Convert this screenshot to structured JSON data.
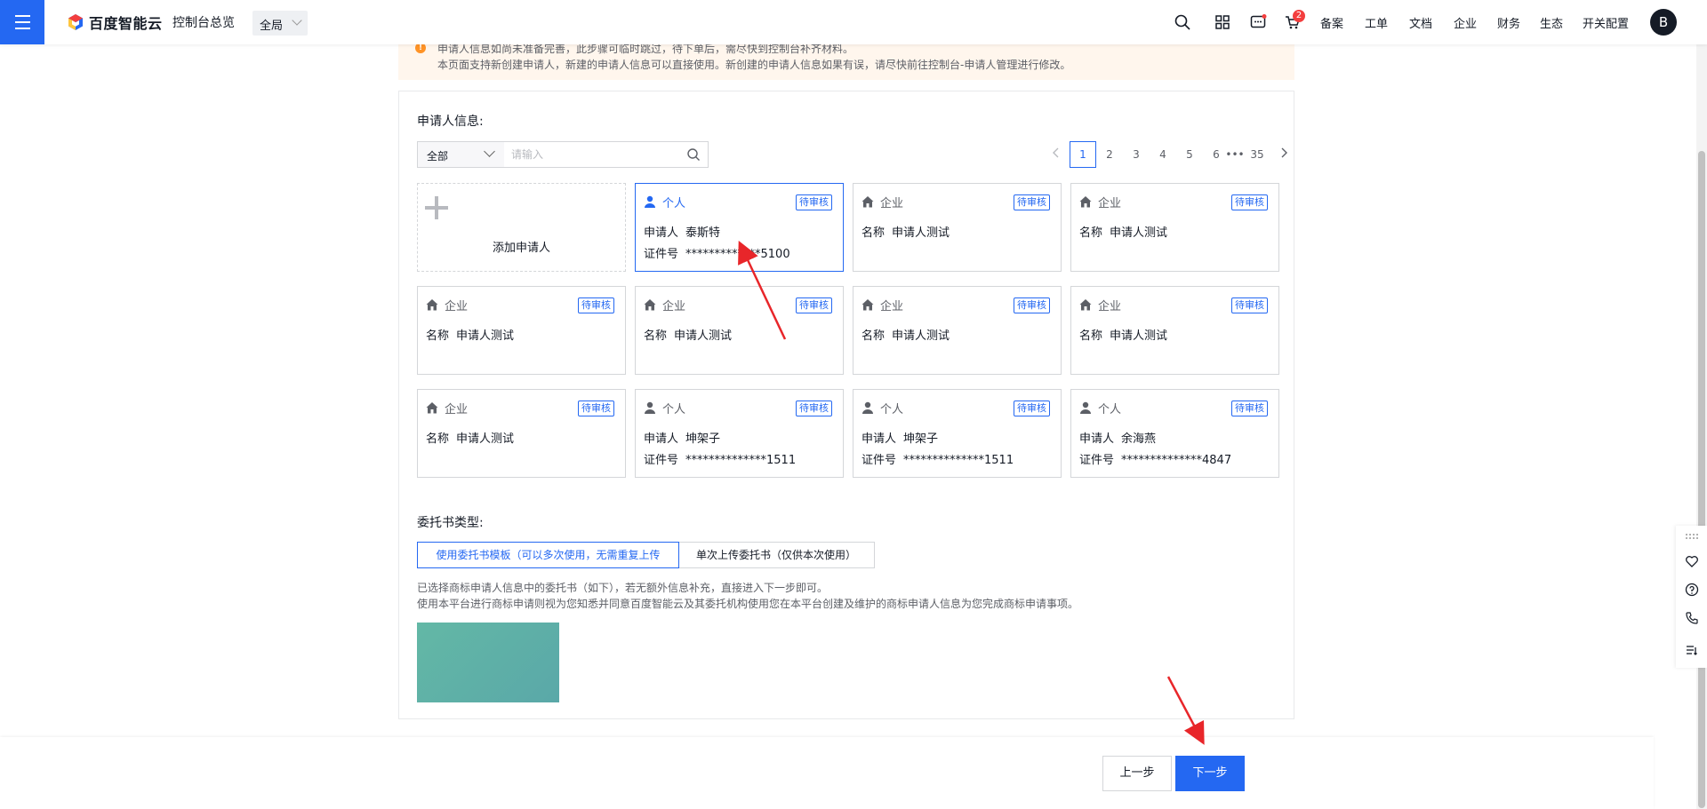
{
  "topbar": {
    "console_label": "控制台总览",
    "region_label": "全局",
    "brand": "百度智能云",
    "cart_badge": "2",
    "links": [
      "备案",
      "工单",
      "文档",
      "企业",
      "财务",
      "生态",
      "开关配置"
    ],
    "avatar_letter": "B"
  },
  "notice": {
    "line1": "申请人信息如尚未准备完善，此步骤可临时跳过，待下单后，需尽快到控制台补齐材料。",
    "line2": "本页面支持新创建申请人，新建的申请人信息可以直接使用。新创建的申请人信息如果有误，请尽快前往控制台-申请人管理进行修改。"
  },
  "applicant": {
    "section_title": "申请人信息:",
    "filter_select": "全部",
    "search_placeholder": "请输入",
    "pagination": {
      "pages": [
        "1",
        "2",
        "3",
        "4",
        "5",
        "6"
      ],
      "ellipsis": "•••",
      "last": "35",
      "current": "1"
    },
    "add_label": "添加申请人",
    "cards": [
      {
        "type": "个人",
        "kind": "person",
        "tag": "待审核",
        "k1": "申请人",
        "v1": "泰斯特",
        "k2": "证件号",
        "v2": "*************5100",
        "selected": true
      },
      {
        "type": "企业",
        "kind": "company",
        "tag": "待审核",
        "k1": "名称",
        "v1": "申请人测试"
      },
      {
        "type": "企业",
        "kind": "company",
        "tag": "待审核",
        "k1": "名称",
        "v1": "申请人测试"
      },
      {
        "type": "企业",
        "kind": "company",
        "tag": "待审核",
        "k1": "名称",
        "v1": "申请人测试"
      },
      {
        "type": "企业",
        "kind": "company",
        "tag": "待审核",
        "k1": "名称",
        "v1": "申请人测试"
      },
      {
        "type": "企业",
        "kind": "company",
        "tag": "待审核",
        "k1": "名称",
        "v1": "申请人测试"
      },
      {
        "type": "企业",
        "kind": "company",
        "tag": "待审核",
        "k1": "名称",
        "v1": "申请人测试"
      },
      {
        "type": "企业",
        "kind": "company",
        "tag": "待审核",
        "k1": "名称",
        "v1": "申请人测试"
      },
      {
        "type": "个人",
        "kind": "person",
        "tag": "待审核",
        "k1": "申请人",
        "v1": "坤架子",
        "k2": "证件号",
        "v2": "**************1511"
      },
      {
        "type": "个人",
        "kind": "person",
        "tag": "待审核",
        "k1": "申请人",
        "v1": "坤架子",
        "k2": "证件号",
        "v2": "**************1511"
      },
      {
        "type": "个人",
        "kind": "person",
        "tag": "待审核",
        "k1": "申请人",
        "v1": "余海燕",
        "k2": "证件号",
        "v2": "**************4847"
      }
    ]
  },
  "entrust": {
    "section_title": "委托书类型:",
    "option_template": "使用委托书模板（可以多次使用，无需重复上传",
    "option_upload": "单次上传委托书（仅供本次使用）",
    "desc1": "已选择商标申请人信息中的委托书（如下），若无额外信息补充，直接进入下一步即可。",
    "desc2": "使用本平台进行商标申请则视为您知悉并同意百度智能云及其委托机构使用您在本平台创建及维护的商标申请人信息为您完成商标申请事项。"
  },
  "footer": {
    "prev_label": "上一步",
    "next_label": "下一步"
  },
  "colors": {
    "primary": "#2468f2",
    "warning": "#ff9326",
    "annotation_arrow": "#e8262a"
  }
}
